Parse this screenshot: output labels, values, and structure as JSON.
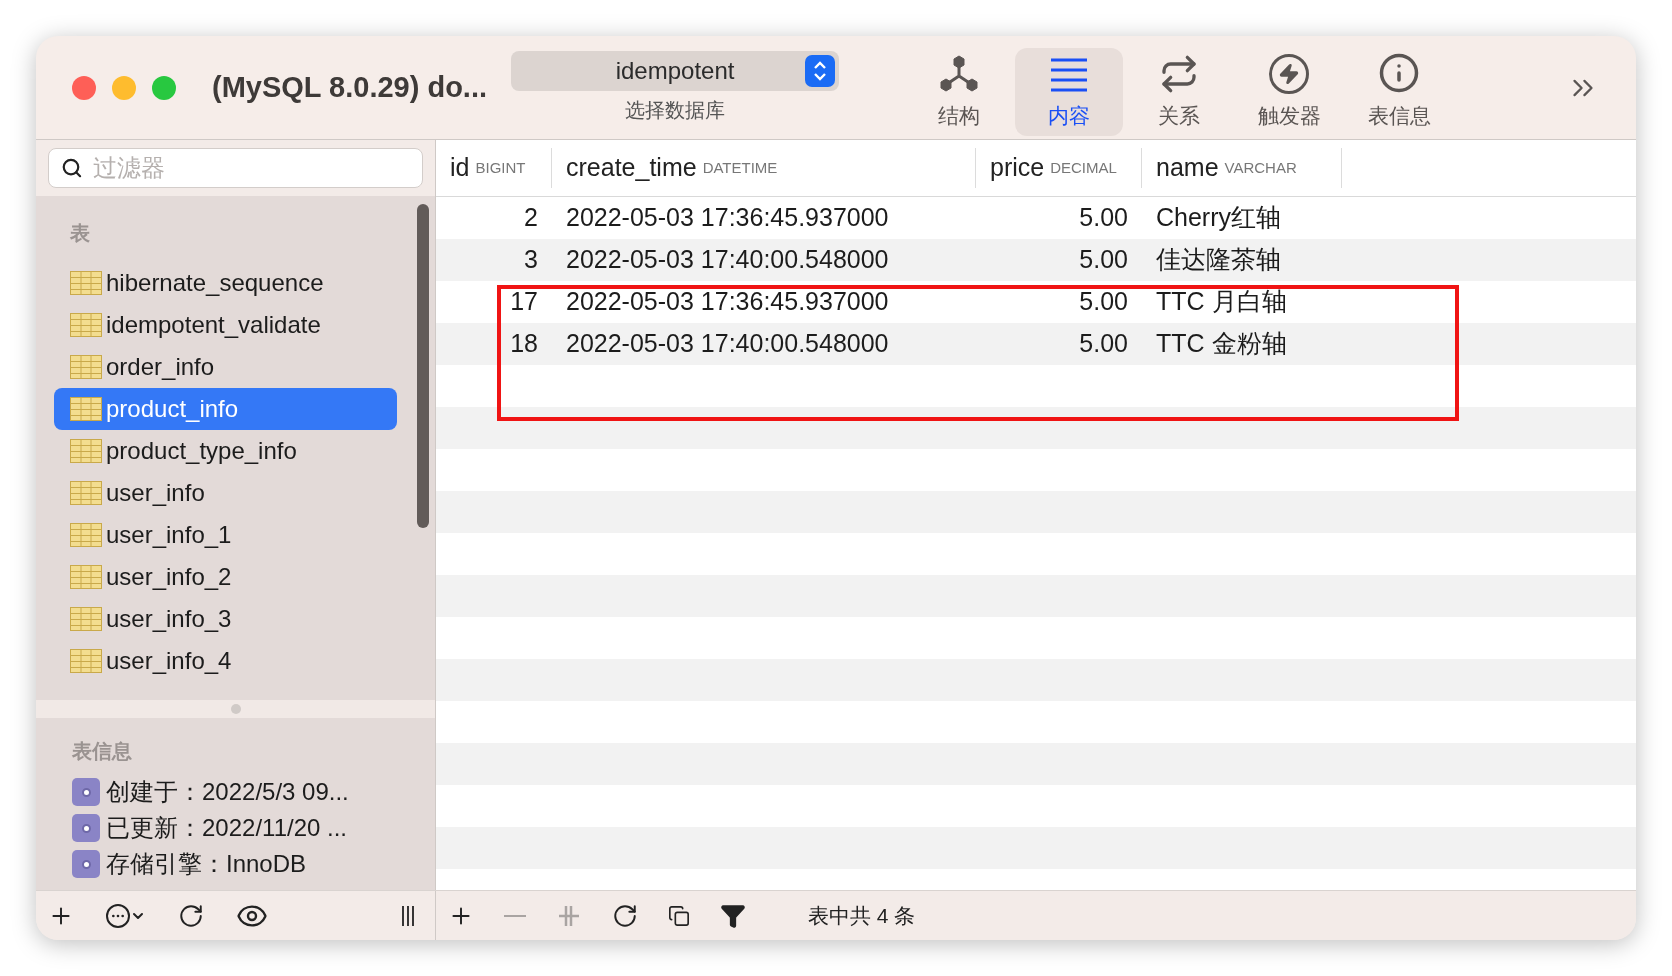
{
  "window": {
    "title": "(MySQL 8.0.29) do...",
    "controls": [
      {
        "color": "#fe5f57"
      },
      {
        "color": "#febc2e"
      },
      {
        "color": "#28c840"
      }
    ]
  },
  "database_selector": {
    "value": "idempotent",
    "label": "选择数据库"
  },
  "toolbar": [
    {
      "kind": "structure",
      "label": "结构",
      "selected": false
    },
    {
      "kind": "content",
      "label": "内容",
      "selected": true
    },
    {
      "kind": "relations",
      "label": "关系",
      "selected": false
    },
    {
      "kind": "triggers",
      "label": "触发器",
      "selected": false
    },
    {
      "kind": "info",
      "label": "表信息",
      "selected": false
    }
  ],
  "sidebar": {
    "search": {
      "placeholder": "过滤器"
    },
    "tables_header": "表",
    "tables": [
      {
        "name": "hibernate_sequence",
        "selected": false
      },
      {
        "name": "idempotent_validate",
        "selected": false
      },
      {
        "name": "order_info",
        "selected": false
      },
      {
        "name": "product_info",
        "selected": true
      },
      {
        "name": "product_type_info",
        "selected": false
      },
      {
        "name": "user_info",
        "selected": false
      },
      {
        "name": "user_info_1",
        "selected": false
      },
      {
        "name": "user_info_2",
        "selected": false
      },
      {
        "name": "user_info_3",
        "selected": false
      },
      {
        "name": "user_info_4",
        "selected": false
      }
    ],
    "info_header": "表信息",
    "info_items": [
      "创建于：2022/5/3 09...",
      "已更新：2022/11/20 ...",
      "存储引擎：InnoDB"
    ],
    "bottom_buttons": [
      {
        "kind": "add"
      },
      {
        "kind": "more"
      },
      {
        "kind": "refresh"
      },
      {
        "kind": "view"
      },
      {
        "kind": "columns"
      }
    ]
  },
  "table": {
    "columns": [
      {
        "name": "id",
        "type": "BIGINT"
      },
      {
        "name": "create_time",
        "type": "DATETIME"
      },
      {
        "name": "price",
        "type": "DECIMAL"
      },
      {
        "name": "name",
        "type": "VARCHAR"
      }
    ],
    "rows": [
      {
        "cells": [
          "2",
          "2022-05-03 17:36:45.937000",
          "5.00",
          "Cherry红轴"
        ],
        "highlighted": false
      },
      {
        "cells": [
          "3",
          "2022-05-03 17:40:00.548000",
          "5.00",
          "佳达隆茶轴"
        ],
        "highlighted": false
      },
      {
        "cells": [
          "17",
          "2022-05-03 17:36:45.937000",
          "5.00",
          "TTC 月白轴"
        ],
        "highlighted": true
      },
      {
        "cells": [
          "18",
          "2022-05-03 17:40:00.548000",
          "5.00",
          "TTC 金粉轴"
        ],
        "highlighted": true
      }
    ]
  },
  "bottom_bar": {
    "buttons": [
      {
        "kind": "add",
        "disabled": false
      },
      {
        "kind": "remove",
        "disabled": true
      },
      {
        "kind": "duplicate",
        "disabled": true
      },
      {
        "kind": "refresh",
        "disabled": false
      },
      {
        "kind": "copy",
        "disabled": false
      },
      {
        "kind": "filter",
        "disabled": false
      }
    ],
    "status": "表中共 4 条"
  }
}
